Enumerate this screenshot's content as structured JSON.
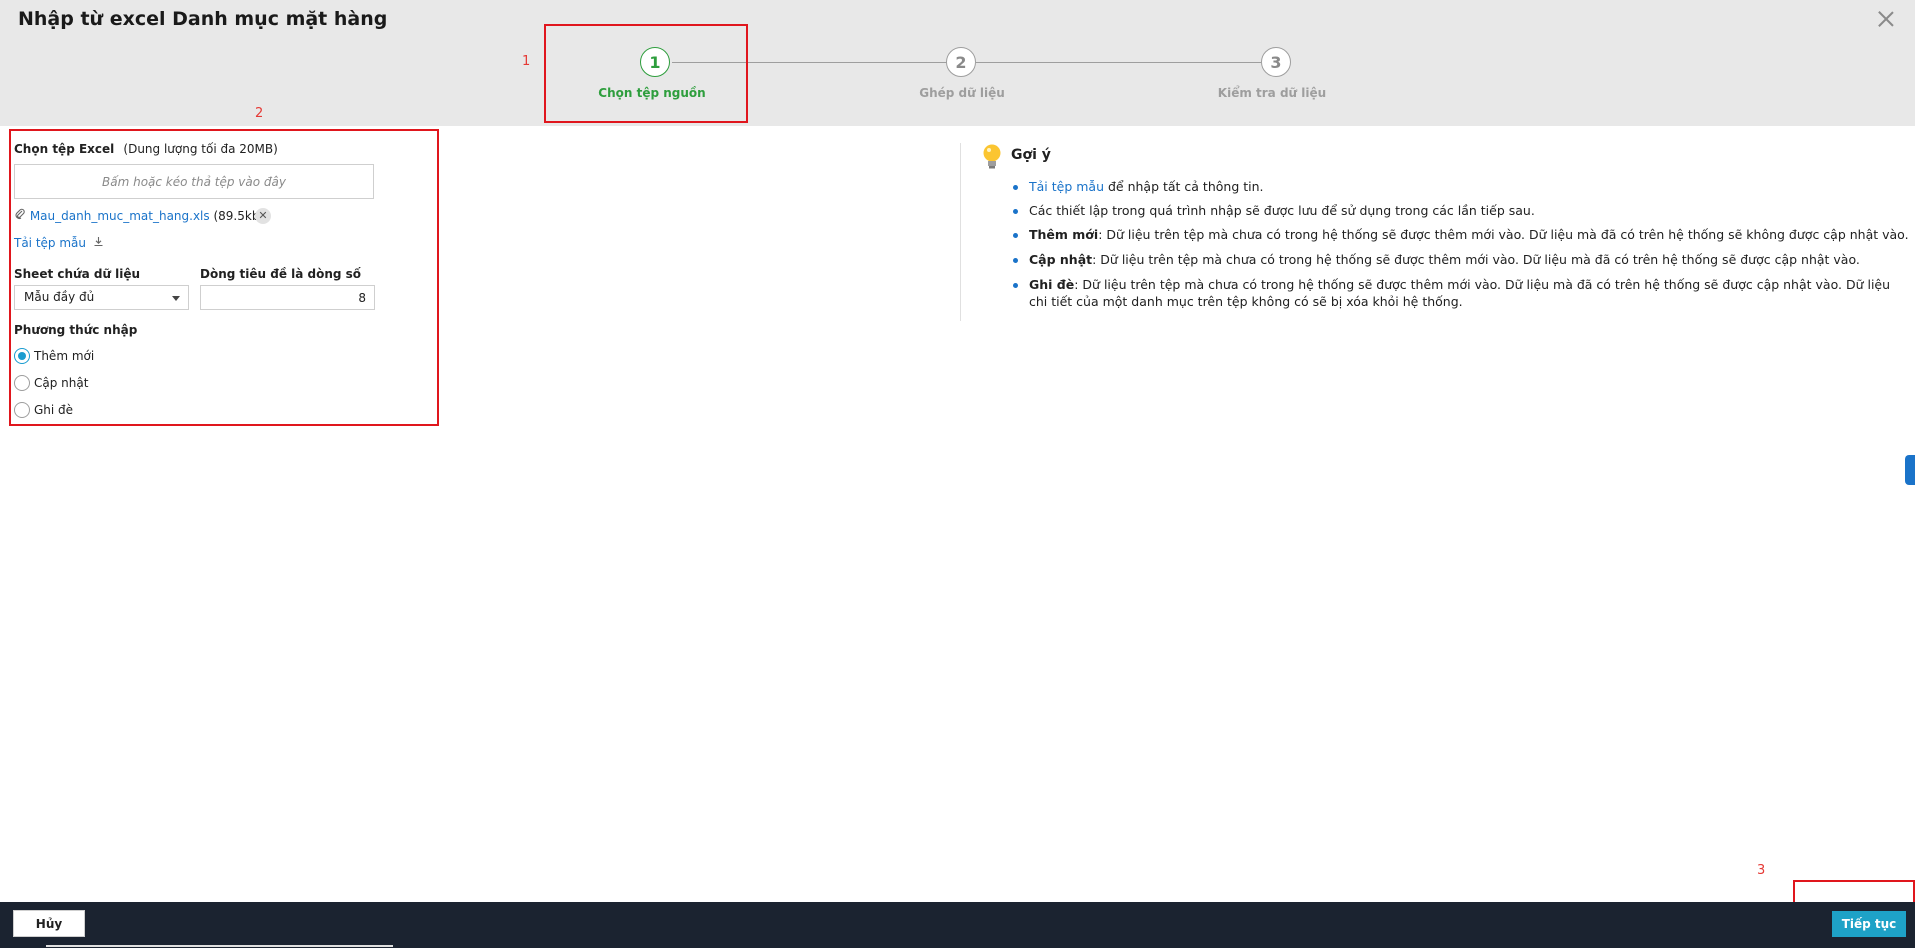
{
  "dialog": {
    "title": "Nhập từ excel Danh mục mặt hàng"
  },
  "annotations": [
    "1",
    "2",
    "3"
  ],
  "steps": [
    {
      "number": "1",
      "label": "Chọn tệp nguồn"
    },
    {
      "number": "2",
      "label": "Ghép dữ liệu"
    },
    {
      "number": "3",
      "label": "Kiểm tra dữ liệu"
    }
  ],
  "form": {
    "file_label": "Chọn tệp Excel",
    "file_hint": "(Dung lượng tối đa 20MB)",
    "dropzone_text": "Bấm hoặc kéo thả tệp vào đây",
    "file_name": "Mau_danh_muc_mat_hang.xls",
    "file_size": "(89.5kb)",
    "remove_glyph": "✕",
    "download_template": "Tải tệp mẫu",
    "sheet_label": "Sheet chứa dữ liệu",
    "sheet_value": "Mẫu đầy đủ",
    "header_row_label": "Dòng tiêu đề là dòng số",
    "header_row_value": "8",
    "import_method_label": "Phương thức nhập",
    "methods": [
      "Thêm mới",
      "Cập nhật",
      "Ghi đè"
    ],
    "selected_method": "Thêm mới"
  },
  "hints": {
    "title": "Gợi ý",
    "item1_link": "Tải tệp mẫu",
    "item1_text": " để nhập tất cả thông tin.",
    "item2_text": "Các thiết lập trong quá trình nhập sẽ được lưu để sử dụng trong các lần tiếp sau.",
    "item3_bold": "Thêm mới",
    "item3_text": ": Dữ liệu trên tệp mà chưa có trong hệ thống sẽ được thêm mới vào. Dữ liệu mà đã có trên hệ thống sẽ không được cập nhật vào.",
    "item4_bold": "Cập nhật",
    "item4_text": ": Dữ liệu trên tệp mà chưa có trong hệ thống sẽ được thêm mới vào. Dữ liệu mà đã có trên hệ thống sẽ được cập nhật vào.",
    "item5_bold": "Ghi đè",
    "item5_text": ": Dữ liệu trên tệp mà chưa có trong hệ thống sẽ được thêm mới vào. Dữ liệu mà đã có trên hệ thống sẽ được cập nhật vào. Dữ liệu chi tiết của một danh mục trên tệp không có sẽ bị xóa khỏi hệ thống."
  },
  "footer": {
    "cancel_label": "Hủy",
    "next_label": "Tiếp tục"
  },
  "colors": {
    "accent": "#1ea2c7",
    "active_step": "#2e9e3d",
    "link": "#1a73c9",
    "annotation": "#e0161d",
    "footer_bg": "#1b2330"
  }
}
